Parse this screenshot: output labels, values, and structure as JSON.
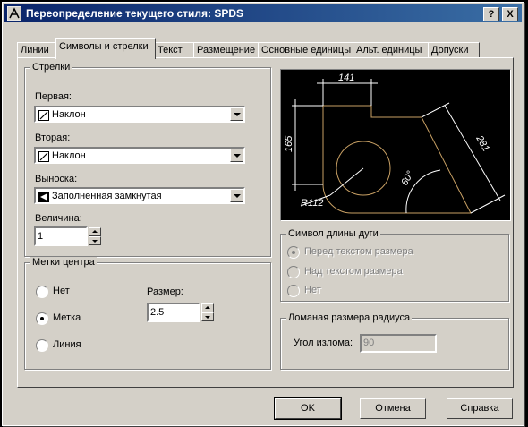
{
  "window": {
    "title": "Переопределение текущего стиля: SPDS",
    "help_label": "?",
    "close_label": "X"
  },
  "tabs": [
    {
      "label": "Линии"
    },
    {
      "label": "Символы и стрелки"
    },
    {
      "label": "Текст"
    },
    {
      "label": "Размещение"
    },
    {
      "label": "Основные единицы"
    },
    {
      "label": "Альт. единицы"
    },
    {
      "label": "Допуски"
    }
  ],
  "arrows": {
    "group_label": "Стрелки",
    "first_label": "Первая:",
    "first_value": "Наклон",
    "second_label": "Вторая:",
    "second_value": "Наклон",
    "leader_label": "Выноска:",
    "leader_value": "Заполненная замкнутая",
    "size_label": "Величина:",
    "size_value": "1"
  },
  "center_marks": {
    "group_label": "Метки центра",
    "options": [
      "Нет",
      "Метка",
      "Линия"
    ],
    "selected": "Метка",
    "size_label": "Размер:",
    "size_value": "2.5"
  },
  "preview": {
    "dim_141": "141",
    "dim_165": "165",
    "dim_281": "281",
    "dim_angle": "60°",
    "dim_radius": "R112"
  },
  "arc_symbol": {
    "group_label": "Символ длины дуги",
    "options": [
      "Перед текстом размера",
      "Над текстом размера",
      "Нет"
    ],
    "selected": "Перед текстом размера"
  },
  "radius_jog": {
    "group_label": "Ломаная размера радиуса",
    "angle_label": "Угол излома:",
    "angle_value": "90"
  },
  "buttons": {
    "ok": "OK",
    "cancel": "Отмена",
    "help": "Справка"
  },
  "colors": {
    "titlebar_start": "#0a246a",
    "titlebar_end": "#3a6ea5",
    "face": "#d4d0c8",
    "preview_bg": "#000000",
    "preview_geometry": "#c8a064",
    "preview_dims": "#ffffff"
  }
}
